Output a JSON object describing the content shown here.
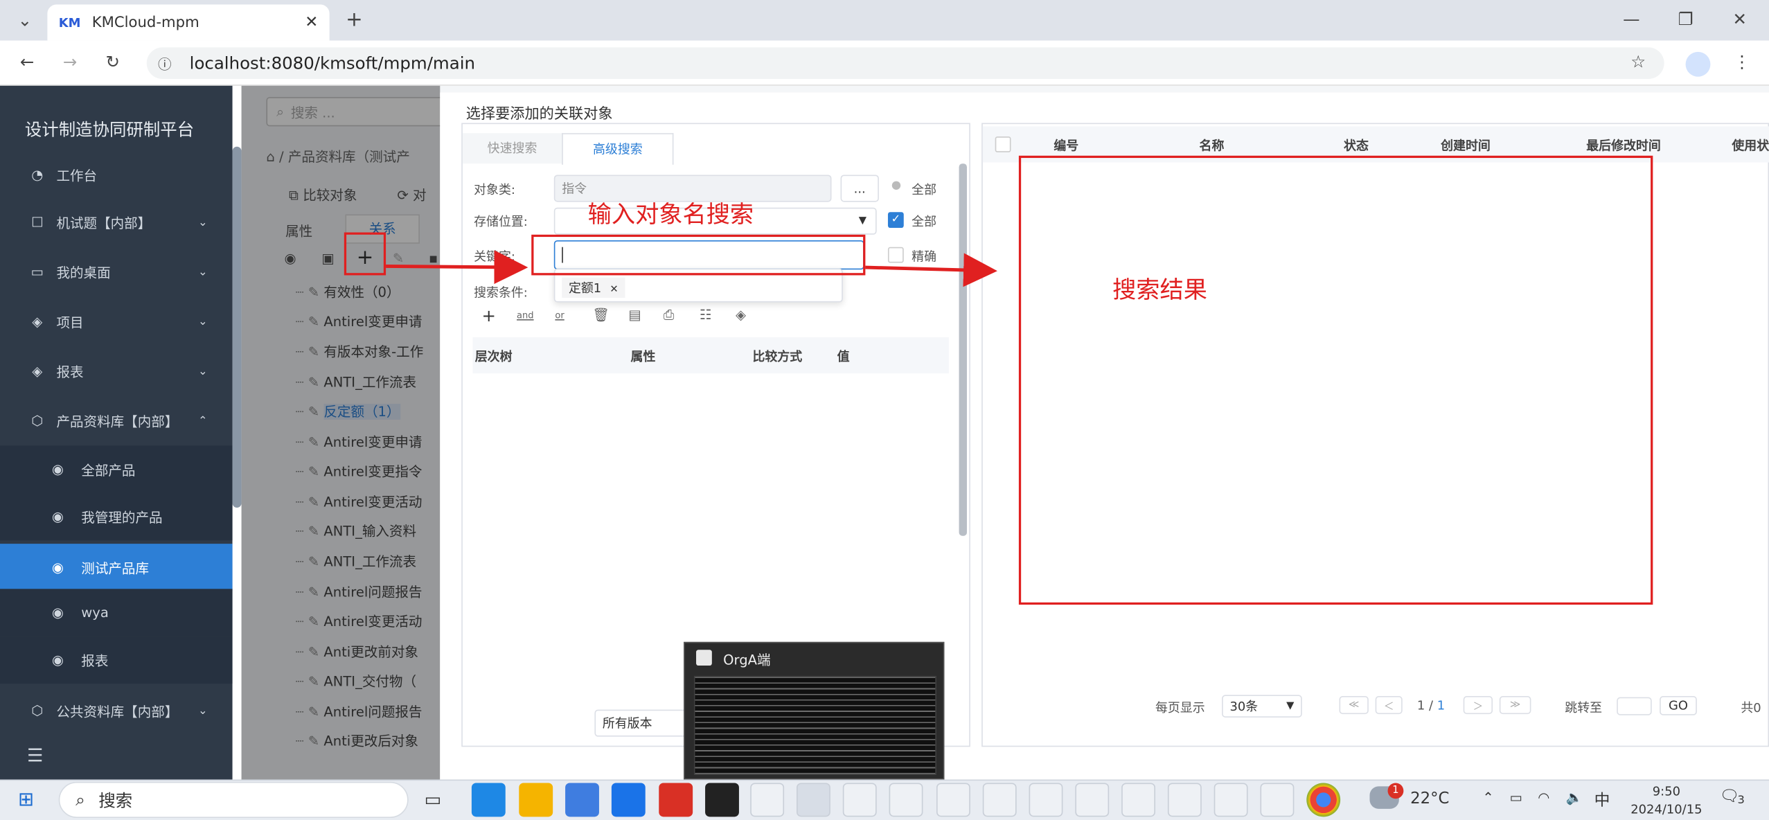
{
  "browser": {
    "tab_title": "KMCloud-mpm",
    "tab_logo": "KM",
    "url": "localhost:8080/kmsoft/mpm/main"
  },
  "sidebar": {
    "title": "设计制造协同研制平台",
    "items": [
      {
        "label": "工作台",
        "icon": "dashboard-icon"
      },
      {
        "label": "机试题【内部】",
        "icon": "square-icon"
      },
      {
        "label": "我的桌面",
        "icon": "monitor-icon"
      },
      {
        "label": "项目",
        "icon": "layers-icon"
      },
      {
        "label": "报表",
        "icon": "layers-icon"
      },
      {
        "label": "产品资料库【内部】",
        "icon": "cube-icon"
      }
    ],
    "sub_items": [
      "全部产品",
      "我管理的产品",
      "测试产品库",
      "wya",
      "报表"
    ],
    "bottom_item": "公共资料库【内部】"
  },
  "background_page": {
    "search_placeholder": "搜索 ...",
    "breadcrumb": "产品资料库（测试产",
    "toolbar_compare": "比较对象",
    "toolbar_other": "对",
    "tabs": [
      "属性",
      "关系"
    ],
    "tree": [
      "有效性（0）",
      "Antirel变更申请",
      "有版本对象-工作",
      "ANTI_工作流表",
      "反定额（1）",
      "Antirel变更申请",
      "Antirel变更指令",
      "Antirel变更活动",
      "ANTI_输入资料",
      "ANTI_工作流表",
      "Antirel问题报告",
      "Antirel变更活动",
      "Anti更改前对象",
      "ANTI_交付物（",
      "Antirel问题报告",
      "Anti更改后对象"
    ]
  },
  "modal": {
    "title": "选择要添加的关联对象",
    "tabs": [
      "快速搜索",
      "高级搜索"
    ],
    "object_class_label": "对象类:",
    "object_class_value": "指令",
    "browse_btn": "...",
    "all_label_1": "全部",
    "storage_label": "存储位置:",
    "all_label_2": "全部",
    "keyword_label": "关键字:",
    "exact_label": "精确",
    "condition_label": "搜索条件:",
    "dropdown_tag": "定额1",
    "cond_columns": [
      "层次树",
      "属性",
      "比较方式",
      "值"
    ],
    "version_select": "所有版本",
    "result_columns": [
      "编号",
      "名称",
      "状态",
      "创建时间",
      "最后修改时间",
      "使用状"
    ],
    "pagination": {
      "per_page_label": "每页显示",
      "per_page_value": "30条",
      "page_current": "1",
      "page_sep": "/",
      "page_total": "1",
      "jump_label": "跳转至",
      "go": "GO",
      "total": "共0"
    }
  },
  "annotations": {
    "input_hint": "输入对象名搜索",
    "result_hint": "搜索结果"
  },
  "popup": {
    "title": "OrgA端"
  },
  "taskbar": {
    "search": "搜索",
    "weather": "22°C",
    "ime": "中",
    "time": "9:50",
    "date": "2024/10/15",
    "notif_count": "3",
    "weather_badge": "1"
  },
  "colors": {
    "sidebar_bg": "#2f3a48",
    "sidebar_active": "#2d7fd6",
    "accent": "#2d7fd6",
    "annotation_red": "#e02020"
  }
}
